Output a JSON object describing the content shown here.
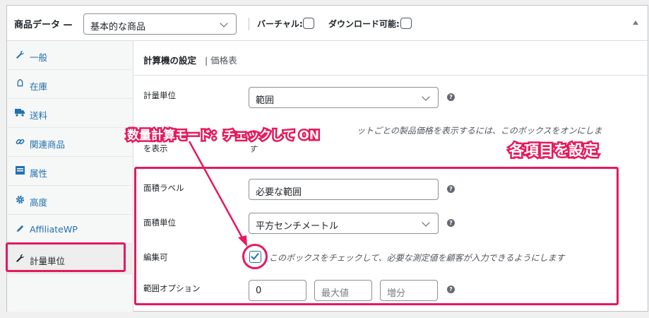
{
  "header": {
    "title": "商品データ —",
    "product_type": "基本的な商品",
    "virtual_label": "バーチャル:",
    "downloadable_label": "ダウンロード可能:"
  },
  "sidebar": {
    "items": [
      {
        "label": "一般",
        "icon": "wrench-icon"
      },
      {
        "label": "在庫",
        "icon": "tag-icon"
      },
      {
        "label": "送料",
        "icon": "truck-icon"
      },
      {
        "label": "関連商品",
        "icon": "link-icon"
      },
      {
        "label": "属性",
        "icon": "list-icon"
      },
      {
        "label": "高度",
        "icon": "gear-icon"
      },
      {
        "label": "AffiliateWP",
        "icon": "pen-icon"
      },
      {
        "label": "計量単位",
        "icon": "wrench-icon",
        "active": true
      }
    ]
  },
  "subheader": {
    "active": "計算機の設定",
    "separator_link": "| 価格表"
  },
  "form": {
    "measurement_unit_label": "計量単位",
    "measurement_unit_value": "範囲",
    "desc_line1_right": "ットごとの製品価格を表示するには、このボックスをオンにしま",
    "desc_line2_left": "を表示",
    "desc_line2_right": "す",
    "area_label_label": "面積ラベル",
    "area_label_value": "必要な範囲",
    "area_unit_label": "面積単位",
    "area_unit_value": "平方センチメートル",
    "editable_label": "編集可",
    "editable_desc": "このボックスをチェックして、必要な測定値を顧客が入力できるようにします",
    "range_option_label": "範囲オプション",
    "range_min_value": "0",
    "range_max_placeholder": "最大値",
    "range_step_placeholder": "増分"
  },
  "annotations": {
    "callout_a": "数量計算モード：チェックして ON",
    "callout_b": "各項目を設定",
    "accent_color": "#e6195a"
  }
}
